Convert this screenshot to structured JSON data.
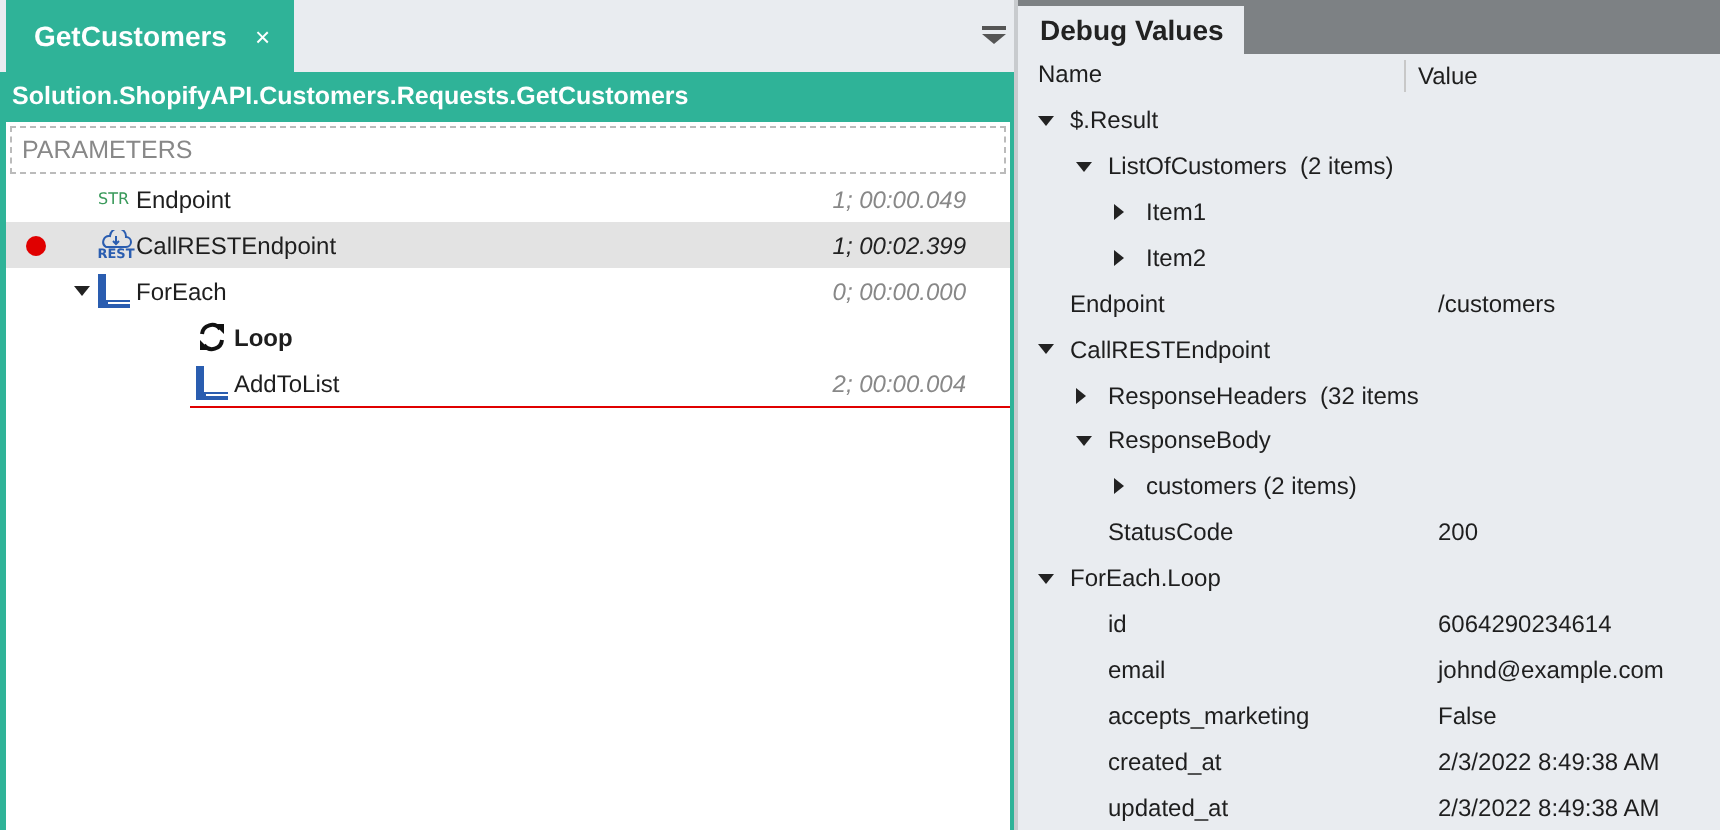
{
  "editor": {
    "tabs": [
      {
        "label": "GetCustomers",
        "close": "×",
        "selected": true
      }
    ],
    "path": "Solution.ShopifyAPI.Customers.Requests.GetCustomers",
    "parameters": {
      "label": "PARAMETERS"
    },
    "steps": [
      {
        "kind": "string",
        "badge": "STR",
        "label": "Endpoint",
        "timing": "1; 00:00.049",
        "breakpoint": false,
        "selected": false,
        "drop_line": false
      },
      {
        "kind": "rest",
        "badge": "REST",
        "label": "CallRESTEndpoint",
        "timing": "1; 00:02.399",
        "breakpoint": true,
        "selected": true,
        "drop_line": false
      },
      {
        "kind": "foreach",
        "label": "ForEach",
        "timing": "0; 00:00.000",
        "breakpoint": false,
        "selected": false,
        "drop_line": false,
        "expanded": true,
        "children": [
          {
            "kind": "loop",
            "label": "Loop",
            "breakpoint": false,
            "selected": false,
            "drop_line": false
          },
          {
            "kind": "block",
            "label": "AddToList",
            "timing": "2; 00:00.004",
            "breakpoint": false,
            "selected": false,
            "drop_line": true
          }
        ]
      }
    ]
  },
  "debug": {
    "tabs": [
      {
        "label": "Debug Values",
        "selected": true
      }
    ],
    "columns": [
      "Name",
      "Value"
    ],
    "rows": [
      {
        "name": "$.Result",
        "expanded": true,
        "children": [
          {
            "name": "ListOfCustomers  (2 items)",
            "expanded": true,
            "children": [
              {
                "name": "Item1",
                "expanded": false
              },
              {
                "name": "Item2",
                "expanded": false
              }
            ]
          }
        ]
      },
      {
        "name": "Endpoint",
        "value": "/customers"
      },
      {
        "name": "CallRESTEndpoint",
        "expanded": true,
        "children": [
          {
            "name": "ResponseHeaders  (32 items",
            "expanded": false
          },
          {
            "name": "ResponseBody",
            "expanded": true,
            "children": [
              {
                "name": "customers (2 items)",
                "expanded": false
              }
            ]
          },
          {
            "name": "StatusCode",
            "value": "200"
          }
        ]
      },
      {
        "name": "ForEach.Loop",
        "expanded": true,
        "children": [
          {
            "name": "id",
            "value": "6064290234614"
          },
          {
            "name": "email",
            "value": "johnd@example.com"
          },
          {
            "name": "accepts_marketing",
            "value": "False"
          },
          {
            "name": "created_at",
            "value": "2/3/2022 8:49:38 AM"
          },
          {
            "name": "updated_at",
            "value": "2/3/2022 8:49:38 AM"
          }
        ]
      }
    ]
  }
}
